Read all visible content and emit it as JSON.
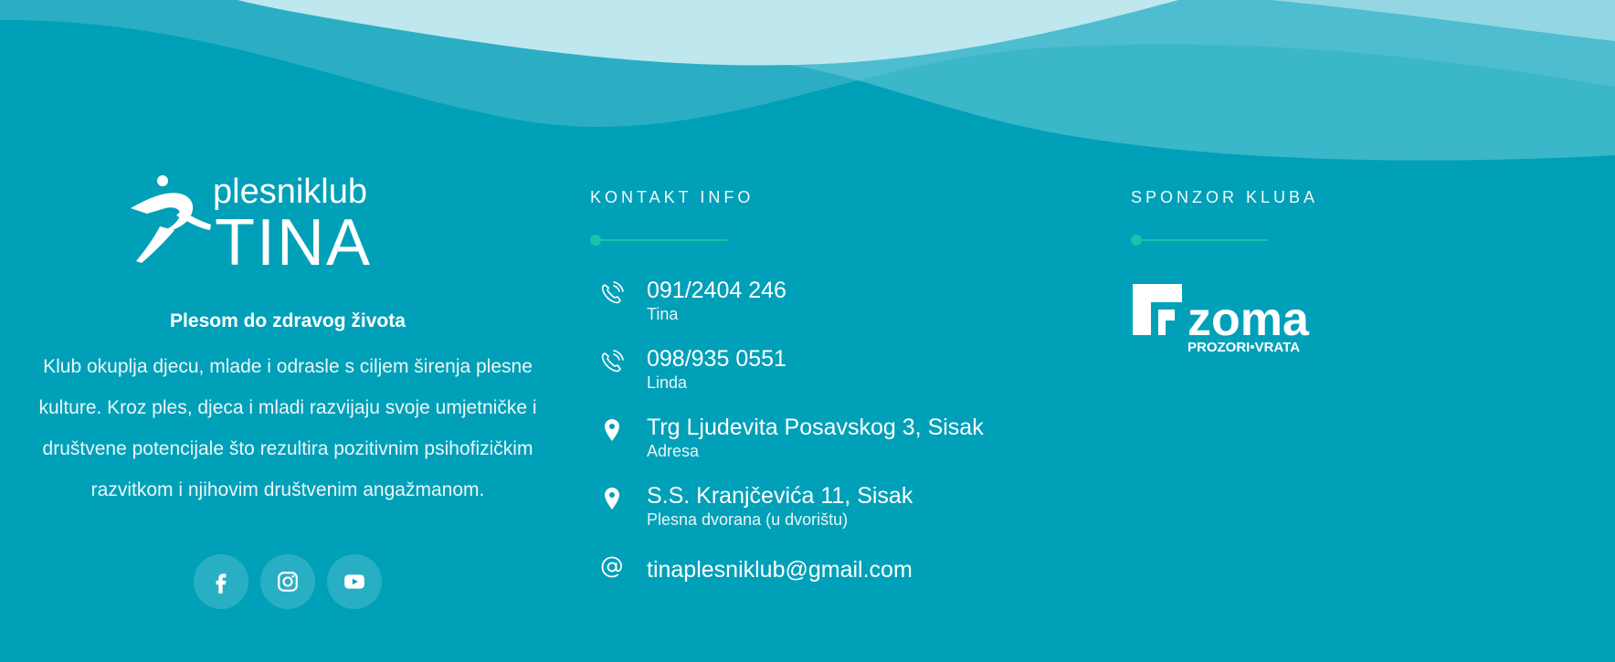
{
  "brand": {
    "logo_text_line1": "plesniklub",
    "logo_text_line2": "TINA",
    "tagline": "Plesom do zdravog života",
    "description": "Klub okuplja djecu, mlade i odrasle s ciljem širenja plesne kulture. Kroz ples, djeca i mladi razvijaju svoje umjetničke i društvene potencijale što rezultira pozitivnim psihofizičkim razvitkom i njihovim društvenim angažmanom."
  },
  "social": [
    {
      "icon": "facebook-icon"
    },
    {
      "icon": "instagram-icon"
    },
    {
      "icon": "youtube-icon"
    }
  ],
  "contact": {
    "heading": "KONTAKT INFO",
    "items": [
      {
        "icon": "phone-icon",
        "main": "091/2404 246",
        "sub": "Tina"
      },
      {
        "icon": "phone-icon",
        "main": "098/935 0551",
        "sub": "Linda"
      },
      {
        "icon": "map-pin-icon",
        "main": "Trg Ljudevita Posavskog 3, Sisak",
        "sub": "Adresa"
      },
      {
        "icon": "map-pin-icon",
        "main": "S.S. Kranjčevića 11, Sisak",
        "sub": "Plesna dvorana (u dvorištu)"
      },
      {
        "icon": "at-sign-icon",
        "main": "tinaplesniklub@gmail.com"
      }
    ]
  },
  "sponsor": {
    "heading": "SPONZOR KLUBA",
    "logo_text": "zoma",
    "logo_subtext": "PROZORI•VRATA"
  },
  "colors": {
    "background": "#00a0b8",
    "accent": "#19c2ad",
    "wave_light": "#bfe7ee"
  }
}
